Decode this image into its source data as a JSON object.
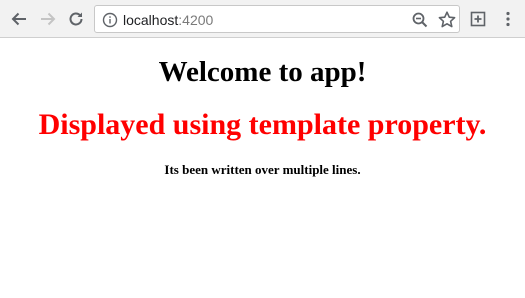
{
  "browser": {
    "url_host": "localhost",
    "url_port": ":4200",
    "icons": {
      "back": "arrow-left-icon",
      "forward": "arrow-right-icon",
      "reload": "reload-icon",
      "site_info": "info-icon",
      "zoom": "zoom-out-icon",
      "bookmark": "star-icon",
      "extension": "extension-plus-icon",
      "menu": "more-vertical-icon"
    }
  },
  "page": {
    "heading": "Welcome to app!",
    "subheading": "Displayed using template property.",
    "subheading_color": "#ff0000",
    "text": "Its been written over multiple lines."
  }
}
